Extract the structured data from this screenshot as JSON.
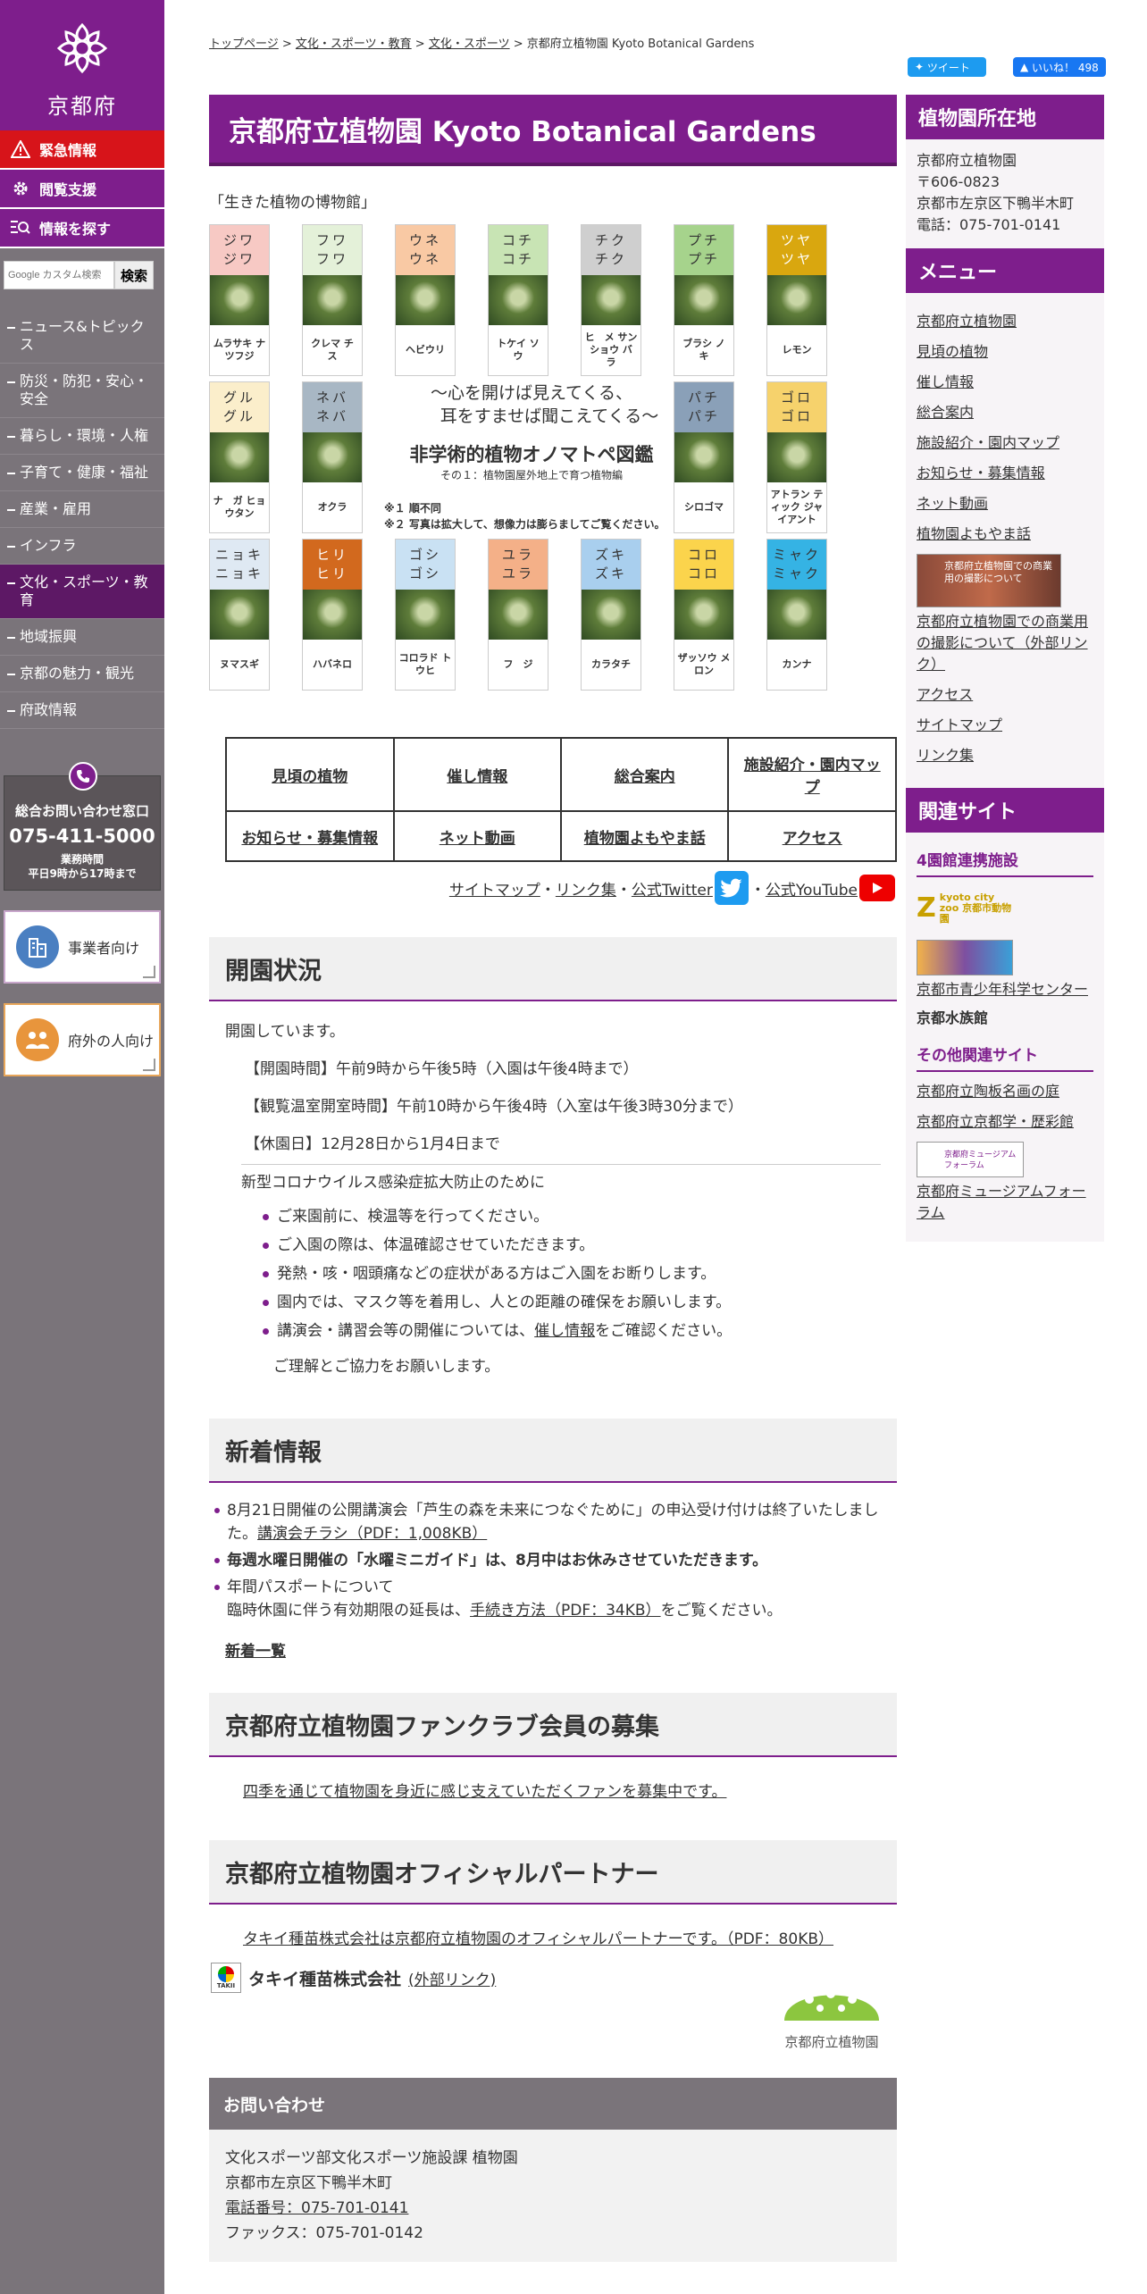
{
  "sidebar": {
    "logo_name": "京都府",
    "emergency": "緊急情報",
    "accessibility": "閲覧支援",
    "find_info": "情報を探す",
    "search_placeholder": "Google カスタム検索",
    "search_button": "検索",
    "nav": [
      "ニュース&トピックス",
      "防災・防犯・安心・安全",
      "暮らし・環境・人権",
      "子育て・健康・福祉",
      "産業・雇用",
      "インフラ",
      "文化・スポーツ・教育",
      "地域振興",
      "京都の魅力・観光",
      "府政情報"
    ],
    "contact_title": "総合お問い合わせ窓口",
    "contact_phone": "075-411-5000",
    "contact_hours_label": "業務時間",
    "contact_hours": "平日9時から17時まで",
    "business": "事業者向け",
    "outside": "府外の人向け"
  },
  "breadcrumb": {
    "items": [
      "トップページ",
      "文化・スポーツ・教育",
      "文化・スポーツ"
    ],
    "current": "京都府立植物園 Kyoto Botanical Gardens"
  },
  "social": {
    "tweet": "ツイート",
    "like": "いいね！ 498"
  },
  "page": {
    "title": "京都府立植物園 Kyoto Botanical Gardens",
    "catch": "「生きた植物の博物館」"
  },
  "zukan": {
    "cards": [
      {
        "top": "ジワ ジワ",
        "name": "ムラサキ ナツフジ",
        "color": "#f7c9c4"
      },
      {
        "top": "フワ フワ",
        "name": "クレマ チ　ス",
        "color": "#e4f1d9"
      },
      {
        "top": "ウネ ウネ",
        "name": "ヘビウリ",
        "color": "#f9c9a4"
      },
      {
        "top": "コチ コチ",
        "name": "トケイ ソ　ウ",
        "color": "#c8e4b4"
      },
      {
        "top": "チク チク",
        "name": "ヒ　メ サンショウ バ　ラ",
        "color": "#cfcfcf"
      },
      {
        "top": "プチ プチ",
        "name": "ブラシ ノ　キ",
        "color": "#a6d38c"
      },
      {
        "top": "ツヤ ツヤ",
        "name": "レモン",
        "color": "#d9a70f"
      },
      {
        "top": "グル グル",
        "name": "ナ　ガ ヒョウタン",
        "color": "#fbeecb"
      },
      {
        "top": "ネバ ネバ",
        "name": "オクラ",
        "color": "#a8b7c4"
      },
      {
        "top": "パチ パチ",
        "name": "シロゴマ",
        "color": "#8aa0b8"
      },
      {
        "top": "ゴロ ゴロ",
        "name": "アトラン ティック ジャイアント",
        "color": "#f6d26c"
      },
      {
        "top": "ニョキ ニョキ",
        "name": "ヌマスギ",
        "color": "#dfe9f3"
      },
      {
        "top": "ヒリ ヒリ",
        "name": "ハバネロ",
        "color": "#d2691e"
      },
      {
        "top": "ゴシ ゴシ",
        "name": "コロラド トウヒ",
        "color": "#c9e1f3"
      },
      {
        "top": "ユラ ユラ",
        "name": "フ　ジ",
        "color": "#f4b088"
      },
      {
        "top": "ズキ ズキ",
        "name": "カラタチ",
        "color": "#a9cfee"
      },
      {
        "top": "コロ コロ",
        "name": "ザッソウ メロン",
        "color": "#fbd44c"
      },
      {
        "top": "ミャク ミャク",
        "name": "カンナ",
        "color": "#35b3e4"
      }
    ],
    "slogan1": "〜心を開けば見えてくる、",
    "slogan2": "耳をすませば聞こえてくる〜",
    "title": "非学術的植物オノマトペ図鑑",
    "subtitle": "その１：植物園屋外地上で育つ植物編",
    "note1": "※１ 順不同",
    "note2": "※２ 写真は拡大して、想像力は膨らましてご覧ください。"
  },
  "quicklinks": [
    "見頃の植物",
    "催し情報",
    "総合案内",
    "施設紹介・園内マップ",
    "お知らせ・募集情報",
    "ネット動画",
    "植物園よもやま話",
    "アクセス"
  ],
  "social_links": {
    "sitemap": "サイトマップ",
    "links": "リンク集",
    "twitter": "公式Twitter",
    "youtube": "公式YouTube"
  },
  "status": {
    "heading": "開園状況",
    "open": "開園しています。",
    "hours": "【開園時間】午前9時から午後5時（入園は午後4時まで）",
    "greenhouse": "【観覧温室開室時間】午前10時から午後4時（入室は午後3時30分まで）",
    "closed": "【休園日】12月28日から1月4日まで",
    "covid_title": "新型コロナウイルス感染症拡大防止のために",
    "bullets": [
      "ご来園前に、検温等を行ってください。",
      "ご入園の際は、体温確認させていただきます。",
      "発熱・咳・咽頭痛などの症状がある方はご入園をお断りします。",
      "園内では、マスク等を着用し、人との距離の確保をお願いします。"
    ],
    "last_bullet_pre": "講演会・講習会等の開催については、",
    "last_bullet_link": "催し情報",
    "last_bullet_post": "をご確認ください。",
    "thanks": "ご理解とご協力をお願いします。"
  },
  "news": {
    "heading": "新着情報",
    "item1": "8月21日開催の公開講演会「芦生の森を未来につなぐために」の申込受け付けは終了いたしました。",
    "item1_link": "講演会チラシ（PDF：1,008KB）",
    "item2": "毎週水曜日開催の「水曜ミニガイド」は、8月中はお休みさせていただきます。",
    "item3": "年間パスポートについて",
    "item3b_pre": "臨時休園に伴う有効期限の延長は、",
    "item3b_link": "手続き方法（PDF：34KB）",
    "item3b_post": "をご覧ください。",
    "list_link": "新着一覧"
  },
  "fanclub": {
    "heading": "京都府立植物園ファンクラブ会員の募集",
    "link": "四季を通じて植物園を身近に感じ支えていただくファンを募集中です。"
  },
  "partner": {
    "heading": "京都府立植物園オフィシャルパートナー",
    "link": "タキイ種苗株式会社は京都府立植物園のオフィシャルパートナーです。（PDF：80KB）",
    "company": "タキイ種苗株式会社",
    "company_logo": "TAKII",
    "external": "(外部リンク)",
    "garden_logo": "京都府立植物園"
  },
  "contact": {
    "heading": "お問い合わせ",
    "dept": "文化スポーツ部文化スポーツ施設課 植物園",
    "address": "京都市左京区下鴨半木町",
    "phone": "電話番号：075-701-0141",
    "fax": "ファックス：075-701-0142"
  },
  "right": {
    "location_head": "植物園所在地",
    "loc_name": "京都府立植物園",
    "loc_zip": "〒606-0823",
    "loc_addr": "京都市左京区下鴨半木町",
    "loc_tel": "電話：075-701-0141",
    "menu_head": "メニュー",
    "menu": [
      "京都府立植物園",
      "見頃の植物",
      "催し情報",
      "総合案内",
      "施設紹介・園内マップ",
      "お知らせ・募集情報",
      "ネット動画",
      "植物園よもやま話"
    ],
    "banner_text": "京都府立植物園での商業用の撮影について",
    "commercial_link": "京都府立植物園での商業用の撮影について（外部リンク）",
    "menu2": [
      "アクセス",
      "サイトマップ",
      "リンク集"
    ],
    "related_head": "関連サイト",
    "four_head": "4園館連携施設",
    "zoo_logo": "kyoto city zoo 京都市動物園",
    "science": "京都市青少年科学センター",
    "aquarium": "京都水族館",
    "other_head": "その他関連サイト",
    "others": [
      "京都府立陶板名画の庭",
      "京都府立京都学・歴彩館"
    ],
    "museum_banner": "京都府ミュージアムフォーラム",
    "museum": "京都府ミュージアムフォーラム"
  }
}
